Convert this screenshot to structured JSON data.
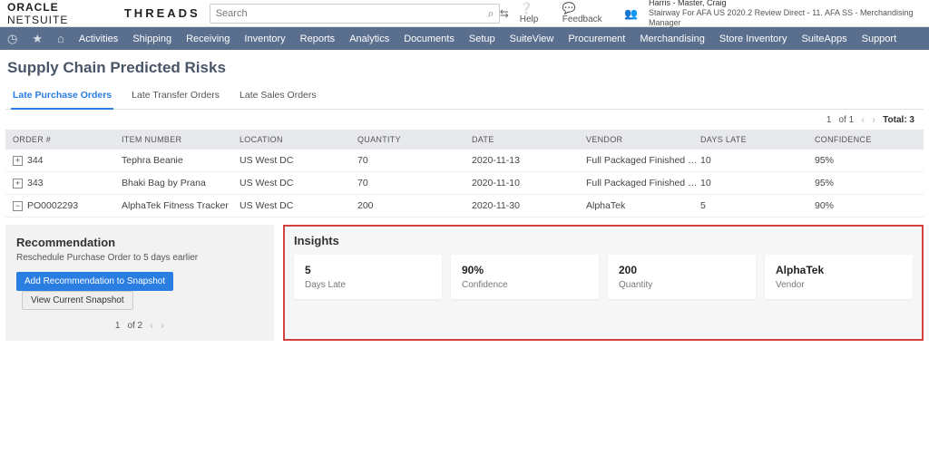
{
  "header": {
    "logo_primary": "ORACLE",
    "logo_secondary": "NETSUITE",
    "brand2": "THREADS",
    "search_placeholder": "Search",
    "help_label": "Help",
    "feedback_label": "Feedback",
    "user_name": "Harris - Master, Craig",
    "user_role": "Stairway For AFA US 2020.2 Review Direct - 11. AFA SS - Merchandising Manager"
  },
  "nav": {
    "items": [
      "Activities",
      "Shipping",
      "Receiving",
      "Inventory",
      "Reports",
      "Analytics",
      "Documents",
      "Setup",
      "SuiteView",
      "Procurement",
      "Merchandising",
      "Store Inventory",
      "SuiteApps",
      "Support"
    ]
  },
  "page": {
    "title": "Supply Chain Predicted Risks",
    "tabs": [
      "Late Purchase Orders",
      "Late Transfer Orders",
      "Late Sales Orders"
    ],
    "active_tab": 0,
    "pager": {
      "page": "1",
      "of": "of 1",
      "total_label": "Total: 3"
    }
  },
  "table": {
    "headers": [
      "ORDER #",
      "ITEM NUMBER",
      "LOCATION",
      "QUANTITY",
      "DATE",
      "VENDOR",
      "DAYS LATE",
      "CONFIDENCE"
    ],
    "rows": [
      {
        "expand": "+",
        "order": "344",
        "item": "Tephra Beanie",
        "location": "US West DC",
        "qty": "70",
        "date": "2020-11-13",
        "vendor": "Full Packaged Finished Good…",
        "days": "10",
        "conf": "95%"
      },
      {
        "expand": "+",
        "order": "343",
        "item": "Bhaki Bag by Prana",
        "location": "US West DC",
        "qty": "70",
        "date": "2020-11-10",
        "vendor": "Full Packaged Finished Good…",
        "days": "10",
        "conf": "95%"
      },
      {
        "expand": "−",
        "order": "PO0002293",
        "item": "AlphaTek Fitness Tracker",
        "location": "US West DC",
        "qty": "200",
        "date": "2020-11-30",
        "vendor": "AlphaTek",
        "days": "5",
        "conf": "90%"
      }
    ]
  },
  "recommendation": {
    "title": "Recommendation",
    "text": "Reschedule Purchase Order to 5 days earlier",
    "primary_btn": "Add Recommendation to Snapshot",
    "secondary_btn": "View Current Snapshot",
    "pager": {
      "page": "1",
      "of": "of 2"
    }
  },
  "insights": {
    "title": "Insights",
    "cards": [
      {
        "value": "5",
        "label": "Days Late"
      },
      {
        "value": "90%",
        "label": "Confidence"
      },
      {
        "value": "200",
        "label": "Quantity"
      },
      {
        "value": "AlphaTek",
        "label": "Vendor"
      }
    ]
  }
}
